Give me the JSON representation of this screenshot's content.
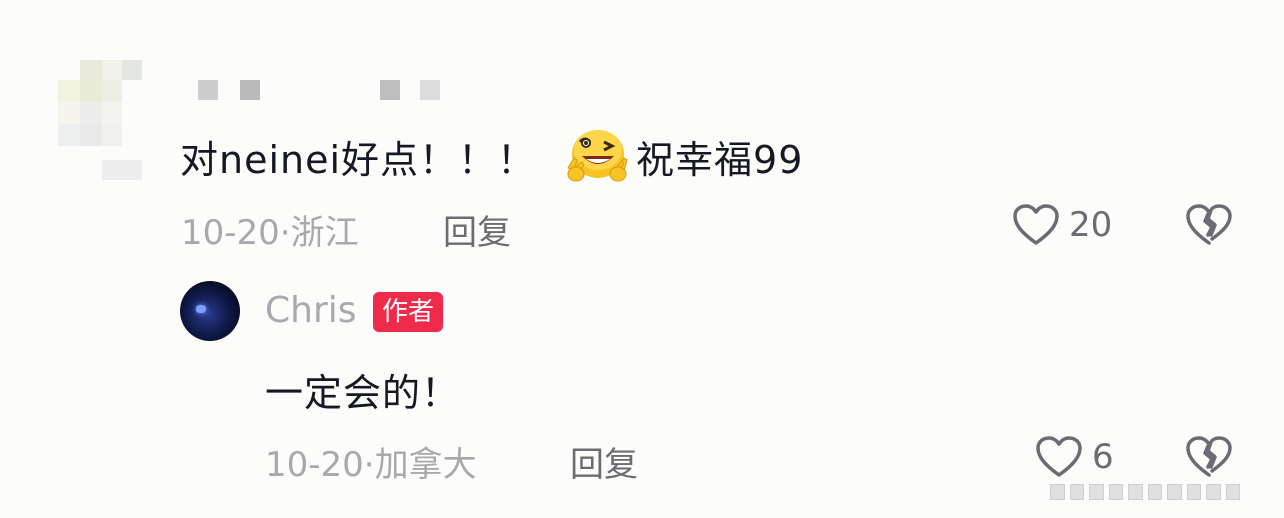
{
  "comment": {
    "text_before_emoji": "对neinei好点！！！",
    "emoji": "grinning-wink-emoji",
    "text_after_emoji": "祝幸福99",
    "date": "10-20",
    "location": "浙江",
    "reply_label": "回复",
    "like_count": "20"
  },
  "reply": {
    "author": "Chris",
    "badge": "作者",
    "text": "一定会的！",
    "date": "10-20",
    "location": "加拿大",
    "reply_label": "回复",
    "like_count": "6"
  },
  "colors": {
    "background": "#fcfcfa",
    "badge": "#f02a4b",
    "text_primary": "#161823",
    "text_meta": "#a8a9ad"
  }
}
